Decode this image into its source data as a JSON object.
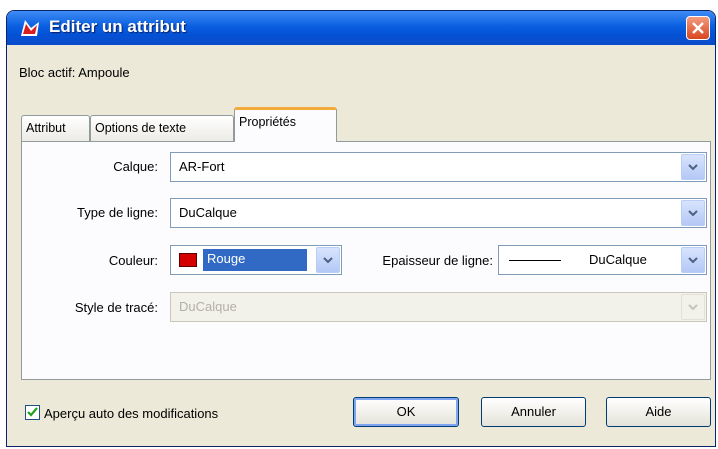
{
  "window": {
    "title": "Editer un attribut",
    "colors": {
      "titlebar": "#0a5fe0",
      "close": "#d8461e",
      "selection": "#316ac5",
      "tab_highlight": "#f3ac3b"
    },
    "icons": {
      "title": "autocad-block-icon",
      "close": "close-icon"
    }
  },
  "active_block": "Bloc actif: Ampoule",
  "tabs": [
    {
      "label": "Attribut"
    },
    {
      "label": "Options de texte"
    },
    {
      "label": "Propriétés",
      "selected": true
    }
  ],
  "properties": {
    "layer": {
      "label": "Calque:",
      "value": "AR-Fort"
    },
    "linetype": {
      "label": "Type de ligne:",
      "value": "DuCalque"
    },
    "color": {
      "label": "Couleur:",
      "value": "Rouge",
      "swatch": "#d40000"
    },
    "lineweight": {
      "label": "Epaisseur de ligne:",
      "value": "DuCalque"
    },
    "plotstyle": {
      "label": "Style de tracé:",
      "value": "DuCalque",
      "disabled": true
    }
  },
  "footer": {
    "preview_checkbox": {
      "label": "Aperçu auto des modifications",
      "checked": true
    },
    "ok_label": "OK",
    "cancel_label": "Annuler",
    "help_label": "Aide"
  }
}
